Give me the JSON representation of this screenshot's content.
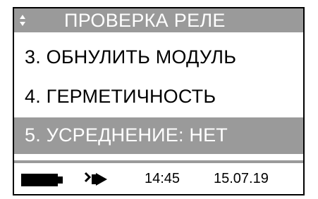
{
  "title": {
    "text": "ПРОВЕРКА РЕЛЕ",
    "icon": "up-down-arrows-icon"
  },
  "menu": {
    "items": [
      {
        "label": "3. ОБНУЛИТЬ МОДУЛЬ",
        "selected": false
      },
      {
        "label": "4. ГЕРМЕТИЧНОСТЬ",
        "selected": false
      },
      {
        "label": "5. УСРЕДНЕНИЕ: НЕТ",
        "selected": true
      }
    ]
  },
  "status": {
    "battery_icon": "battery-icon",
    "power_icon": "plug-icon",
    "time": "14:45",
    "date": "15.07.19"
  },
  "colors": {
    "highlight": "#9a9a9a",
    "text": "#000000",
    "inverse_text": "#ffffff"
  }
}
